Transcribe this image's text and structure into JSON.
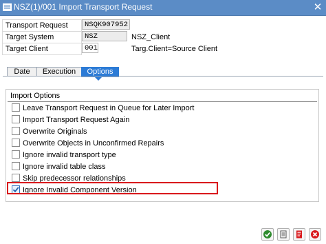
{
  "window": {
    "title": "NSZ(1)/001 Import Transport Request",
    "close_glyph": "✕"
  },
  "fields": [
    {
      "label": "Transport Request",
      "value": "NSQK907952",
      "description": ""
    },
    {
      "label": "Target System",
      "value": "NSZ",
      "description": "NSZ_Client"
    },
    {
      "label": "Target Client",
      "value": "001",
      "description": "Targ.Client=Source Client"
    }
  ],
  "tabs": [
    {
      "label": "Date",
      "active": false
    },
    {
      "label": "Execution",
      "active": false
    },
    {
      "label": "Options",
      "active": true
    }
  ],
  "options_group": {
    "title": "Import Options",
    "items": [
      {
        "label": "Leave Transport Request in Queue for Later Import",
        "checked": false
      },
      {
        "label": "Import Transport Request Again",
        "checked": false
      },
      {
        "label": "Overwrite Originals",
        "checked": false
      },
      {
        "label": "Overwrite Objects in Unconfirmed Repairs",
        "checked": false
      },
      {
        "label": "Ignore invalid transport type",
        "checked": false
      },
      {
        "label": "Ignore invalid table class",
        "checked": false
      },
      {
        "label": "Skip predecessor relationships",
        "checked": false
      },
      {
        "label": "Ignore Invalid Component Version",
        "checked": true
      }
    ]
  },
  "footer_buttons": [
    {
      "icon": "checkmark-icon",
      "color": "#2e8b2e"
    },
    {
      "icon": "multiple-selection-icon",
      "color": "#555555"
    },
    {
      "icon": "document-icon",
      "color": "#d9191c"
    },
    {
      "icon": "cancel-icon",
      "color": "#d9191c"
    }
  ],
  "colors": {
    "titlebar": "#5b8cc6",
    "active_tab": "#2c7bd6",
    "highlight": "#d9191c"
  }
}
